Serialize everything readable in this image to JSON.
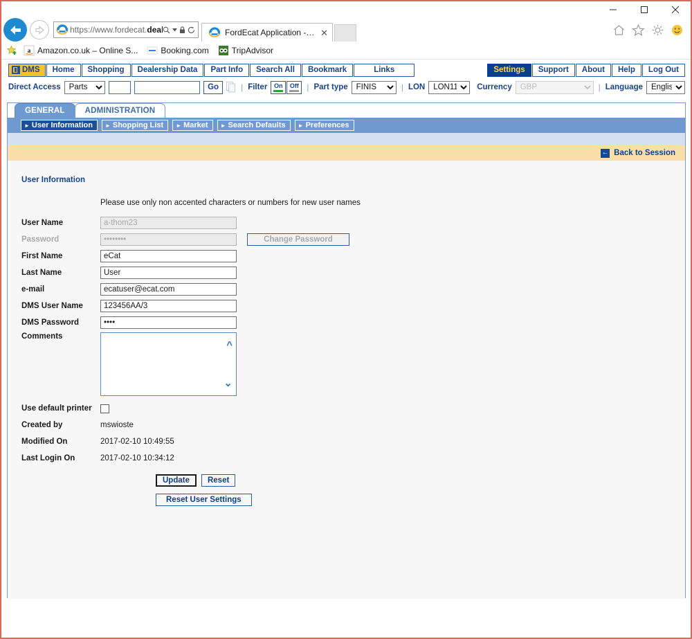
{
  "browser": {
    "window_controls": {
      "minimize": "minimize-icon",
      "maximize": "maximize-icon",
      "close": "close-icon"
    },
    "address": {
      "url_plain": "https://www.fordecat.",
      "url_bold": "deal...",
      "full_url": "https://www.fordecat.deal..."
    },
    "address_icons": [
      "search-icon",
      "dropdown-caret-icon",
      "lock-icon",
      "refresh-icon"
    ],
    "tab": {
      "title": "FordEcat Application - Wel...",
      "close": "✕"
    },
    "command_icons": [
      "home-icon",
      "favorites-star-icon",
      "tools-gear-icon",
      "smiley-feedback-icon"
    ],
    "favorites": [
      {
        "label": "Amazon.co.uk – Online S...",
        "icon": "amazon-icon"
      },
      {
        "label": "Booking.com",
        "icon": "booking-icon"
      },
      {
        "label": "TripAdvisor",
        "icon": "tripadvisor-icon"
      }
    ]
  },
  "toolbar": {
    "main_buttons": [
      "DMS",
      "Home",
      "Shopping",
      "Dealership Data",
      "Part Info",
      "Search All",
      "Bookmark",
      "Links"
    ],
    "right_buttons": [
      "Settings",
      "Support",
      "About",
      "Help",
      "Log Out"
    ],
    "active_right_button": "Settings",
    "direct_access_label": "Direct Access",
    "direct_access_select": "Parts",
    "direct_access_input1": "",
    "direct_access_input2": "",
    "go_label": "Go",
    "filter_label": "Filter",
    "filter_on": "On",
    "filter_off": "Off",
    "part_type_label": "Part type",
    "part_type_value": "FINIS",
    "lon_label": "LON",
    "lon_value": "LON11",
    "currency_label": "Currency",
    "currency_value": "GBP",
    "language_label": "Language",
    "language_value": "English"
  },
  "panel": {
    "tabs": [
      {
        "label": "GENERAL",
        "active": true
      },
      {
        "label": "ADMINISTRATION",
        "active": false
      }
    ],
    "subtabs": [
      {
        "label": "User Information",
        "active": true
      },
      {
        "label": "Shopping List",
        "active": false
      },
      {
        "label": "Market",
        "active": false
      },
      {
        "label": "Search Defaults",
        "active": false
      },
      {
        "label": "Preferences",
        "active": false
      }
    ],
    "back_to_session": "Back to Session"
  },
  "form": {
    "section_title": "User Information",
    "hint": "Please use only non accented characters or numbers for new user names",
    "fields": [
      {
        "label": "User Name",
        "value": "a-thom23",
        "disabled": true
      },
      {
        "label": "Password",
        "value": "••••••••",
        "disabled": true
      },
      {
        "label": "First Name",
        "value": "eCat",
        "disabled": false
      },
      {
        "label": "Last Name",
        "value": "User",
        "disabled": false
      },
      {
        "label": "e-mail",
        "value": "ecatuser@ecat.com",
        "disabled": false
      },
      {
        "label": "DMS User Name",
        "value": "123456AA/3",
        "disabled": false
      },
      {
        "label": "DMS Password",
        "value": "••••",
        "disabled": false
      }
    ],
    "change_password_label": "Change Password",
    "comments_label": "Comments",
    "comments_value": "",
    "use_default_printer_label": "Use default printer",
    "use_default_printer_checked": false,
    "created_by_label": "Created by",
    "created_by_value": "mswioste",
    "modified_on_label": "Modified On",
    "modified_on_value": "2017-02-10 10:49:55",
    "last_login_label": "Last Login On",
    "last_login_value": "2017-02-10 10:34:12",
    "update_label": "Update",
    "reset_label": "Reset",
    "reset_user_settings_label": "Reset User Settings"
  },
  "colors": {
    "window_border": "#d9695a",
    "brand_blue": "#16438f",
    "active_tab_blue": "#6f9ad1",
    "active_button_blue": "#0a3f8f",
    "dms_gold": "#f7c030",
    "yellow_bar": "#fae0a8",
    "light_blue_strip": "#d3e1f3",
    "filter_on_green": "#2f9e3f"
  }
}
